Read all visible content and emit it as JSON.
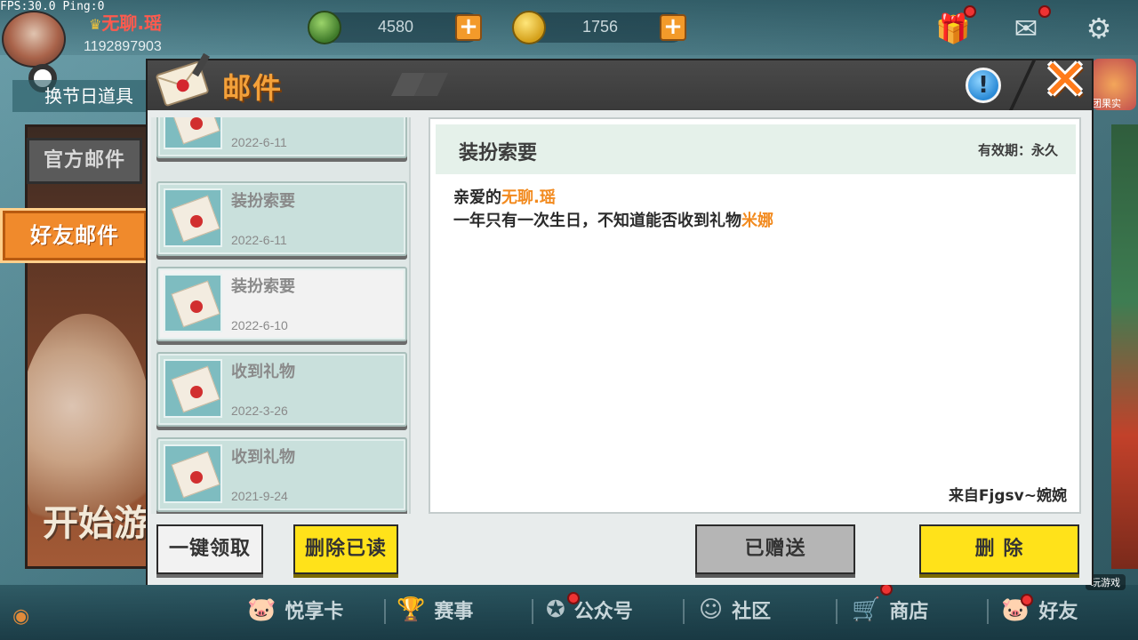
{
  "hud": {
    "fps": "FPS:30.0  Ping:0",
    "player_name": "无聊.瑶",
    "player_id": "1192897903",
    "currency_mini": "4580",
    "currency_coin": "1756",
    "holiday_label": "换节日道具",
    "right_item_label": "团果实"
  },
  "side_tabs": {
    "official": "官方邮件",
    "friend": "好友邮件"
  },
  "background": {
    "start_text": "开始游"
  },
  "mail": {
    "title": "邮件",
    "info_symbol": "!",
    "close_symbol": "✕",
    "items": [
      {
        "title": "",
        "date": "2022-6-11"
      },
      {
        "title": "装扮索要",
        "date": "2022-6-11"
      },
      {
        "title": "装扮索要",
        "date": "2022-6-10"
      },
      {
        "title": "收到礼物",
        "date": "2022-3-26"
      },
      {
        "title": "收到礼物",
        "date": "2021-9-24"
      }
    ],
    "detail": {
      "title": "装扮索要",
      "validity": "有效期：永久",
      "greeting_prefix": "亲爱的",
      "greeting_name": "无聊.瑶",
      "body_prefix": "一年只有一次生日，不知道能否收到礼物",
      "body_item": "米娜",
      "from": "来自Fjgsv~婉婉"
    },
    "buttons": {
      "claim_all": "一键领取",
      "delete_read": "删除已读",
      "gifted": "已赠送",
      "delete": "删 除"
    }
  },
  "bottom_nav": {
    "items": [
      "悦享卡",
      "赛事",
      "公众号",
      "社区",
      "商店",
      "好友"
    ],
    "tag": "玩游戏"
  },
  "colors": {
    "accent_orange": "#f08a2c",
    "title_orange": "#f4a13a",
    "button_yellow": "#ffe21a",
    "highlight_text": "#f28a1e",
    "name_red": "#ff5a4e"
  }
}
